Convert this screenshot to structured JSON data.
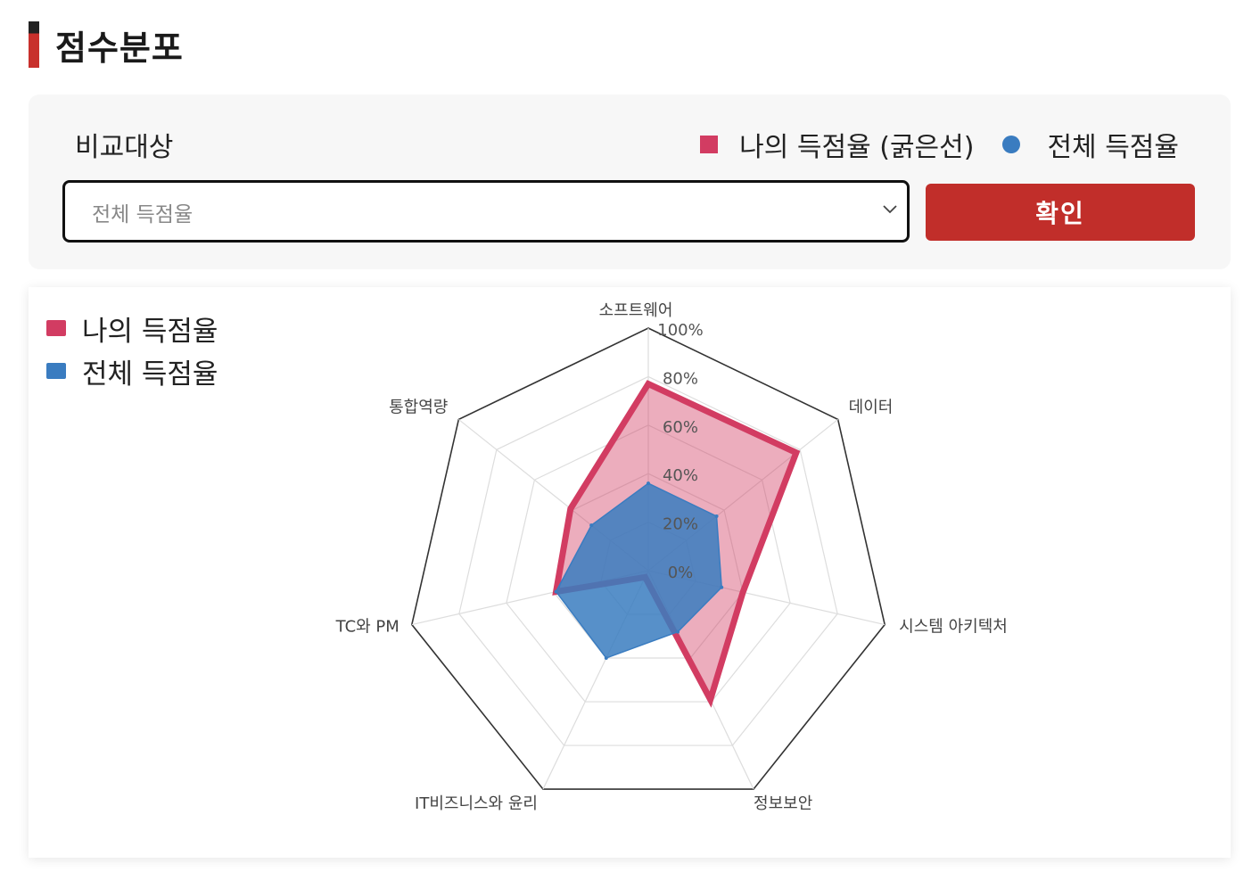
{
  "header": {
    "title": "점수분포"
  },
  "compare": {
    "label": "비교대상",
    "legend_my": "나의 득점율 (굵은선)",
    "legend_all": "전체 득점율",
    "select_value": "전체 득점율",
    "confirm_label": "확인"
  },
  "colors": {
    "my_series": "#d23c62",
    "all_series": "#3a7cc0",
    "confirm_button": "#c12e2a",
    "title_accent": "#c8302c"
  },
  "icons": {
    "select_arrow": "chevron-down-icon"
  },
  "chart_data": {
    "type": "radar",
    "categories": [
      "소프트웨어",
      "데이터",
      "시스템 아키텍처",
      "정보보안",
      "IT비즈니스와 윤리",
      "TC와 PM",
      "통합역량"
    ],
    "tick_labels": [
      "0%",
      "20%",
      "40%",
      "60%",
      "80%",
      "100%"
    ],
    "rlim": [
      0,
      100
    ],
    "grid": true,
    "legend_position": "top-left",
    "series": [
      {
        "name": "나의 득점율",
        "values": [
          77,
          78,
          40,
          59,
          3,
          39,
          41
        ]
      },
      {
        "name": "전체 득점율",
        "values": [
          36,
          36,
          31,
          28,
          40,
          39,
          30
        ]
      }
    ]
  }
}
